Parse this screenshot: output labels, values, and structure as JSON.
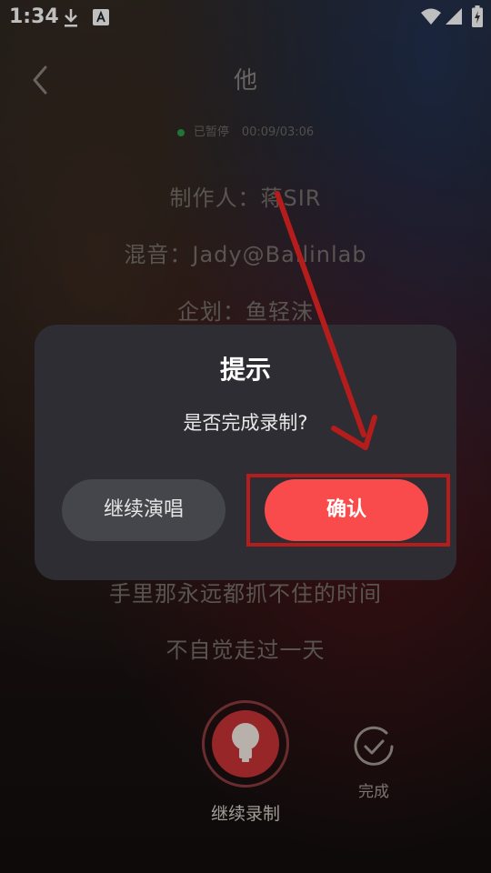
{
  "status_bar": {
    "time": "1:34",
    "icons": [
      "download-icon",
      "text-a-icon",
      "wifi-icon",
      "signal-icon",
      "battery-icon"
    ]
  },
  "header": {
    "title": "他",
    "back_icon": "chevron-left-icon"
  },
  "recording": {
    "state": "已暂停",
    "progress": "00:09/03:06"
  },
  "lyrics": [
    "制作人：蒋SIR",
    "混音：Jady@Ballinlab",
    "企划：鱼轻沫",
    "手里那永远都抓不住的时间",
    "不自觉走过一天"
  ],
  "dialog": {
    "title": "提示",
    "message": "是否完成录制?",
    "continue_label": "继续演唱",
    "confirm_label": "确认"
  },
  "controls": {
    "record_label": "继续录制",
    "done_label": "完成"
  },
  "colors": {
    "confirm": "#fa4b4c",
    "annotation": "#b51c1c",
    "dialog_bg": "#2d2d33"
  }
}
